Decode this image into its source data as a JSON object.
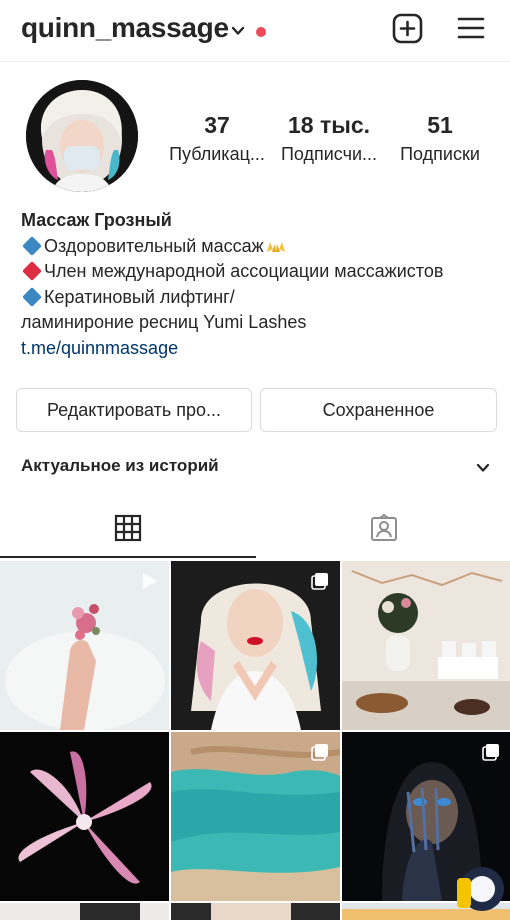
{
  "header": {
    "username": "quinn_massage",
    "icons": [
      "chevron-down-icon",
      "new-post-icon",
      "menu-icon"
    ],
    "live_dot_color": "#ed4956"
  },
  "stats": {
    "posts": {
      "value": "37",
      "label": "Публикац..."
    },
    "followers": {
      "value": "18 тыс.",
      "label": "Подписчи..."
    },
    "following": {
      "value": "51",
      "label": "Подписки"
    }
  },
  "bio": {
    "name": "Массаж Грозный",
    "lines": [
      "Оздоровительный массаж",
      "Член международной ассоциации массажистов",
      "Кератиновый лифтинг/",
      "ламинироние ресниц Yumi Lashes"
    ],
    "link": "t.me/quinnmassage",
    "link_color": "#00376b"
  },
  "buttons": {
    "edit": "Редактировать про...",
    "saved": "Сохраненное"
  },
  "highlights": {
    "title": "Актуальное из историй"
  },
  "tabs": {
    "active": "grid",
    "items": [
      "grid-icon",
      "tagged-icon"
    ]
  },
  "posts": [
    {
      "subject": "hand with pink petals on white",
      "badge": "video-icon"
    },
    {
      "subject": "portrait blonde with blue hair",
      "badge": "multiple-icon"
    },
    {
      "subject": "ramadan table decor",
      "badge": ""
    },
    {
      "subject": "pink lily on black",
      "badge": ""
    },
    {
      "subject": "turquoise lagoon aerial",
      "badge": "multiple-icon"
    },
    {
      "subject": "face with blue eyes dark",
      "badge": "multiple-icon"
    }
  ]
}
